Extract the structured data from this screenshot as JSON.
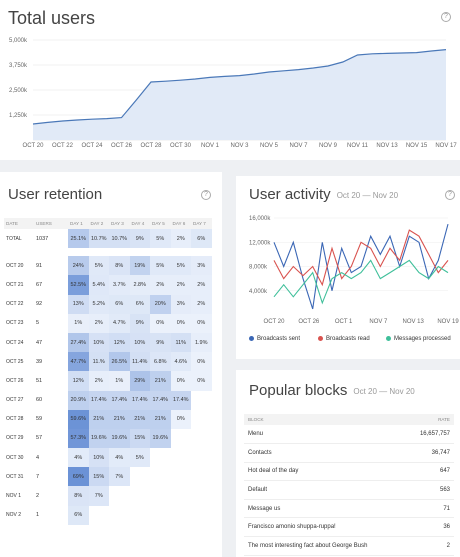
{
  "total_users": {
    "title": "Total users",
    "help": "?",
    "chart_data": {
      "type": "area",
      "x": [
        "OCT 20",
        "OCT 21",
        "OCT 22",
        "OCT 23",
        "OCT 24",
        "OCT 25",
        "OCT 26",
        "OCT 27",
        "OCT 28",
        "OCT 29",
        "OCT 30",
        "OCT 31",
        "NOV 1",
        "NOV 2",
        "NOV 3",
        "NOV 4",
        "NOV 5",
        "NOV 6",
        "NOV 7",
        "NOV 8",
        "NOV 9",
        "NOV 10",
        "NOV 11",
        "NOV 12",
        "NOV 13",
        "NOV 14",
        "NOV 15",
        "NOV 16",
        "NOV 17"
      ],
      "x_tick_labels": [
        "OCT 20",
        "OCT 22",
        "OCT 24",
        "OCT 26",
        "OCT 28",
        "OCT 30",
        "NOV 1",
        "NOV 3",
        "NOV 5",
        "NOV 7",
        "NOV 9",
        "NOV 11",
        "NOV 13",
        "NOV 15",
        "NOV 17"
      ],
      "values": [
        800,
        880,
        950,
        1000,
        1040,
        1070,
        1120,
        2000,
        2900,
        2940,
        2990,
        3050,
        3130,
        3180,
        3220,
        3300,
        3400,
        3460,
        3520,
        3600,
        3700,
        3900,
        4250,
        4310,
        4330,
        4350,
        4370,
        4450,
        4520
      ],
      "y_tick_labels": [
        "1,250k",
        "2,500k",
        "3,750k",
        "5,000k"
      ],
      "ylim": [
        0,
        5000
      ],
      "color": "#4a78b8",
      "fill": "#e1eaf7"
    }
  },
  "retention": {
    "title": "User retention",
    "help": "?",
    "headers": [
      "DATE",
      "USERS",
      "DAY 1",
      "DAY 2",
      "DAY 3",
      "DAY 4",
      "DAY 5",
      "DAY 6",
      "DAY 7"
    ],
    "total": {
      "label": "TOTAL",
      "users": "1037",
      "cells": [
        "25.1%",
        "10.7%",
        "10.7%",
        "9%",
        "5%",
        "2%",
        "6%"
      ],
      "values": [
        25.1,
        10.7,
        10.7,
        9,
        5,
        2,
        6
      ]
    },
    "rows": [
      {
        "label": "OCT 20",
        "users": "91",
        "cells": [
          "24%",
          "5%",
          "8%",
          "19%",
          "5%",
          "5%",
          "3%"
        ],
        "values": [
          24,
          5,
          8,
          19,
          5,
          5,
          3
        ]
      },
      {
        "label": "OCT 21",
        "users": "67",
        "cells": [
          "52.5%",
          "5.4%",
          "3.7%",
          "2.8%",
          "2%",
          "2%",
          "2%"
        ],
        "values": [
          52.5,
          5.4,
          3.7,
          2.8,
          2,
          2,
          2
        ]
      },
      {
        "label": "OCT 22",
        "users": "92",
        "cells": [
          "13%",
          "5.2%",
          "6%",
          "6%",
          "20%",
          "3%",
          "2%"
        ],
        "values": [
          13,
          5.2,
          6,
          6,
          20,
          3,
          2
        ]
      },
      {
        "label": "OCT 23",
        "users": "5",
        "cells": [
          "1%",
          "2%",
          "4.7%",
          "9%",
          "0%",
          "0%",
          "0%"
        ],
        "values": [
          1,
          2,
          4.7,
          9,
          0,
          0,
          0
        ]
      },
      {
        "label": "OCT 24",
        "users": "47",
        "cells": [
          "27.4%",
          "10%",
          "12%",
          "10%",
          "9%",
          "11%",
          "1.9%"
        ],
        "values": [
          27.4,
          10,
          12,
          10,
          9,
          11,
          1.9
        ]
      },
      {
        "label": "OCT 25",
        "users": "39",
        "cells": [
          "47.7%",
          "11.%",
          "26.5%",
          "11.4%",
          "6.8%",
          "4.6%",
          "0%"
        ],
        "values": [
          47.7,
          11,
          26.5,
          11.4,
          6.8,
          4.6,
          0
        ]
      },
      {
        "label": "OCT 26",
        "users": "51",
        "cells": [
          "12%",
          "2%",
          "1%",
          "29%",
          "21%",
          "0%",
          "0%"
        ],
        "values": [
          12,
          2,
          1,
          29,
          21,
          0,
          0
        ]
      },
      {
        "label": "OCT 27",
        "users": "60",
        "cells": [
          "20.9%",
          "17.4%",
          "17.4%",
          "17.4%",
          "17.4%",
          "17.4%",
          ""
        ],
        "values": [
          20.9,
          17.4,
          17.4,
          17.4,
          17.4,
          17.4,
          null
        ]
      },
      {
        "label": "OCT 28",
        "users": "59",
        "cells": [
          "59.6%",
          "21%",
          "21%",
          "21%",
          "21%",
          "0%",
          ""
        ],
        "values": [
          59.6,
          21,
          21,
          21,
          21,
          0,
          null
        ]
      },
      {
        "label": "OCT 29",
        "users": "57",
        "cells": [
          "57.3%",
          "19.6%",
          "19.6%",
          "15%",
          "19.6%",
          "",
          ""
        ],
        "values": [
          57.3,
          19.6,
          19.6,
          15,
          19.6,
          null,
          null
        ]
      },
      {
        "label": "OCT 30",
        "users": "4",
        "cells": [
          "4%",
          "10%",
          "4%",
          "5%",
          "",
          "",
          ""
        ],
        "values": [
          4,
          10,
          4,
          5,
          null,
          null,
          null
        ]
      },
      {
        "label": "OCT 31",
        "users": "7",
        "cells": [
          "69%",
          "15%",
          "7%",
          "",
          "",
          "",
          ""
        ],
        "values": [
          69,
          15,
          7,
          null,
          null,
          null,
          null
        ]
      },
      {
        "label": "NOV 1",
        "users": "2",
        "cells": [
          "8%",
          "7%",
          "",
          "",
          "",
          "",
          ""
        ],
        "values": [
          8,
          7,
          null,
          null,
          null,
          null,
          null
        ]
      },
      {
        "label": "NOV 2",
        "users": "1",
        "cells": [
          "6%",
          "",
          "",
          "",
          "",
          "",
          ""
        ],
        "values": [
          6,
          null,
          null,
          null,
          null,
          null,
          null
        ]
      }
    ]
  },
  "activity": {
    "title": "User activity",
    "subtitle": "Oct 20 — Nov 20",
    "help": "?",
    "chart_data": {
      "type": "line",
      "x": [
        1,
        2,
        3,
        4,
        5,
        6,
        7,
        8,
        9,
        10,
        11,
        12,
        13,
        14,
        15,
        16,
        17,
        18,
        19
      ],
      "x_tick_labels": [
        "OCT 20",
        "OCT 26",
        "OCT 1",
        "NOV 7",
        "NOV 13",
        "NOV 19"
      ],
      "y_tick_labels": [
        "4,000k",
        "8,000k",
        "12,000k",
        "16,000k"
      ],
      "ylim": [
        0,
        16000
      ],
      "series": [
        {
          "name": "Broadcasts sent",
          "color": "#3b67b5",
          "values": [
            12000,
            8000,
            12000,
            6000,
            1000,
            12000,
            4000,
            11000,
            7000,
            8000,
            13000,
            10000,
            13000,
            8000,
            13000,
            12000,
            6000,
            9000,
            15000
          ]
        },
        {
          "name": "Broadcasts read",
          "color": "#d9534f",
          "values": [
            9000,
            6000,
            8000,
            6500,
            8000,
            5000,
            11000,
            6000,
            8000,
            12000,
            11000,
            8000,
            11000,
            9000,
            14000,
            13000,
            10000,
            7000,
            9000
          ]
        },
        {
          "name": "Messages processed",
          "color": "#3fbf9a",
          "values": [
            3000,
            5000,
            3000,
            5000,
            7000,
            2000,
            6000,
            7000,
            6000,
            7000,
            9000,
            6000,
            7000,
            8000,
            9000,
            7000,
            6000,
            8000,
            7000
          ]
        }
      ]
    }
  },
  "popular": {
    "title": "Popular blocks",
    "subtitle": "Oct 20 — Nov 20",
    "headers": {
      "block": "BLOCK",
      "rate": "RATE"
    },
    "rows": [
      {
        "block": "Menu",
        "rate": "16,657,757"
      },
      {
        "block": "Contacts",
        "rate": "36,747"
      },
      {
        "block": "Hot deal of the day",
        "rate": "647"
      },
      {
        "block": "Default",
        "rate": "563"
      },
      {
        "block": "Message us",
        "rate": "71"
      },
      {
        "block": "Francisco amonio shuppa-ruppa!",
        "rate": "36"
      },
      {
        "block": "The most interesting fact about George Bush",
        "rate": "2"
      }
    ]
  }
}
